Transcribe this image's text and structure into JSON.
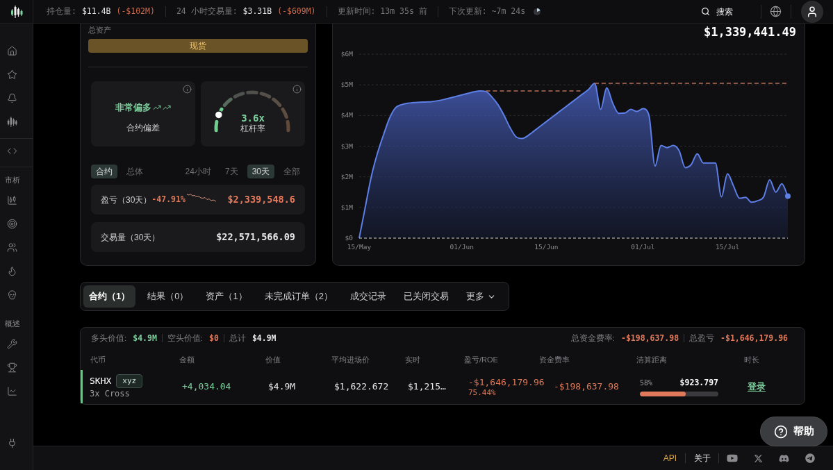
{
  "top_bar": {
    "stats": [
      {
        "label": "持仓量:",
        "value": "$11.4B",
        "change": "(-$102M)"
      },
      {
        "label": "24 小时交易量:",
        "value": "$3.31B",
        "change": "(-$609M)"
      }
    ],
    "updated": "更新时间: 13m 35s 前",
    "next_update": "下次更新: ~7m 24s",
    "search": "搜索"
  },
  "sidebar": {
    "section_labels": [
      "市析",
      "概述"
    ]
  },
  "overview": {
    "title": "总资产",
    "spot_button": "现货",
    "bias": {
      "value": "非常偏多",
      "label": "合约偏差"
    },
    "leverage": {
      "value": "3.6x",
      "label": "杠杆率",
      "level": 0.15
    },
    "scope_tabs": [
      {
        "label": "合约",
        "selected": true
      },
      {
        "label": "总体",
        "selected": false
      }
    ],
    "period_tabs": [
      {
        "label": "24小时",
        "selected": false
      },
      {
        "label": "7天",
        "selected": false
      },
      {
        "label": "30天",
        "selected": true
      },
      {
        "label": "全部",
        "selected": false
      }
    ],
    "pnl": {
      "label": "盈亏（30天）",
      "change": "-47.91%",
      "value": "$2,339,548.6"
    },
    "volume": {
      "label": "交易量（30天）",
      "value": "$22,571,566.09"
    }
  },
  "chart_panel": {
    "total_value": "$1,339,441.49",
    "chart_data": [
      {
        "type": "area",
        "x": [
          "--05-15",
          "--05-16",
          "--05-17",
          "--05-18",
          "--05-19",
          "--05-20",
          "--05-21",
          "--05-22",
          "--05-23",
          "--05-24",
          "--05-25",
          "--05-26",
          "--05-27",
          "--05-28",
          "--05-29",
          "--05-30",
          "--05-31",
          "--06-01",
          "--06-02",
          "--06-03",
          "--06-04",
          "--06-05",
          "--06-06",
          "--06-07",
          "--06-08",
          "--06-09",
          "--06-10",
          "--06-11",
          "--06-12",
          "--06-13",
          "--06-14",
          "--06-15",
          "--06-16",
          "--06-17",
          "--06-18",
          "--06-19",
          "--06-20",
          "--06-21",
          "--06-22",
          "--06-23",
          "--06-24",
          "--06-25",
          "--06-26",
          "--06-27",
          "--06-28",
          "--06-29",
          "--06-30",
          "--07-01",
          "--07-02",
          "--07-03",
          "--07-04",
          "--07-05",
          "--07-06",
          "--07-07",
          "--07-08",
          "--07-09",
          "--07-10",
          "--07-11",
          "--07-12",
          "--07-13",
          "--07-14",
          "--07-15",
          "--07-16",
          "--07-17",
          "--07-18",
          "--07-19",
          "--07-20",
          "--07-21",
          "--07-22",
          "--07-23",
          "--07-24",
          "--07-25"
        ],
        "series": [
          {
            "color": "#5d7fe6",
            "values": [
              0,
              1000000,
              2000000,
              2750000,
              3350000,
              3900000,
              4250000,
              4350000,
              4400000,
              4420000,
              4430000,
              4440000,
              4450000,
              4480000,
              4520000,
              4570000,
              4620000,
              4670000,
              4720000,
              4770000,
              4800000,
              4780000,
              4600000,
              4350000,
              4000000,
              3600000,
              3300000,
              3250000,
              3350000,
              3500000,
              3650000,
              3800000,
              3950000,
              4100000,
              4250000,
              4400000,
              4550000,
              4700000,
              4850000,
              5050000,
              4200000,
              4900000,
              4400000,
              4070000,
              4080000,
              4200000,
              4130000,
              4220000,
              4000000,
              2350000,
              3020000,
              2950000,
              3020000,
              2850000,
              2300000,
              2400000,
              2750000,
              2450000,
              2450000,
              2450000,
              1350000,
              2100000,
              1700000,
              1300000,
              1330000,
              1170000,
              1220000,
              1350000,
              1900000,
              1500000,
              1770000,
              1370000
            ]
          },
          {
            "type": "line",
            "line_style": "dashed",
            "color": "#b8705a",
            "values": [
              null,
              null,
              null,
              null,
              null,
              null,
              null,
              null,
              null,
              null,
              null,
              null,
              null,
              null,
              null,
              null,
              null,
              null,
              null,
              null,
              null,
              4800000,
              4800000,
              4800000,
              4800000,
              4800000,
              4800000,
              4800000,
              4800000,
              4800000,
              4800000,
              4800000,
              4800000,
              4800000,
              4800000,
              4800000,
              4800000,
              4800000,
              null,
              5050000,
              5050000,
              5050000,
              5050000,
              5050000,
              5050000,
              5050000,
              5050000,
              5050000,
              5050000,
              5050000,
              5050000,
              5050000,
              5050000,
              5050000,
              5050000,
              5050000,
              5050000,
              5050000,
              5050000,
              5050000,
              5050000,
              5050000,
              5050000,
              5050000,
              5050000,
              5050000,
              5050000,
              5050000,
              5050000,
              5050000,
              5050000,
              5050000
            ]
          }
        ],
        "xlim": [
          "--05-15",
          "--07-25"
        ],
        "ylim": [
          0,
          6000000
        ],
        "yticks": [
          {
            "value": 0,
            "label": "$0"
          },
          {
            "value": 1000000,
            "label": "$1M"
          },
          {
            "value": 2000000,
            "label": "$2M"
          },
          {
            "value": 3000000,
            "label": "$3M"
          },
          {
            "value": 4000000,
            "label": "$4M"
          },
          {
            "value": 5000000,
            "label": "$5M"
          },
          {
            "value": 6000000,
            "label": "$6M"
          }
        ],
        "xticks": [
          {
            "value": "--05-15",
            "label": "15/May"
          },
          {
            "value": "--06-01",
            "label": "01/Jun"
          },
          {
            "value": "--06-15",
            "label": "15/Jun"
          },
          {
            "value": "--07-01",
            "label": "01/Jul"
          },
          {
            "value": "--07-15",
            "label": "15/Jul"
          }
        ],
        "grid": true
      }
    ]
  },
  "position_tabs": [
    {
      "label": "合约（1）",
      "selected": true,
      "kind": "tab"
    },
    {
      "label": "结果（0）",
      "selected": false,
      "kind": "tab"
    },
    {
      "label": "资产（1）",
      "selected": false,
      "kind": "tab"
    },
    {
      "label": "未完成订单（2）",
      "selected": false,
      "kind": "tab"
    },
    {
      "label": "成交记录",
      "selected": false,
      "kind": "tab"
    },
    {
      "label": "已关闭交易",
      "selected": false,
      "kind": "tab"
    },
    {
      "label": "更多",
      "selected": false,
      "kind": "dropdown"
    }
  ],
  "positions": {
    "summary_left": [
      {
        "label": "多头价值:",
        "value": "$4.9M",
        "color": "#7ccf9c"
      },
      {
        "label": "空头价值:",
        "value": "$0",
        "color": "#e07a5a"
      },
      {
        "label": "总计",
        "value": "$4.9M",
        "color": "#e6e6e6"
      }
    ],
    "summary_right": [
      {
        "label": "总资金费率:",
        "value": "-$198,637.98"
      },
      {
        "label": "总盈亏",
        "value": "-$1,646,179.96"
      }
    ],
    "columns": [
      "代币",
      "金额",
      "价值",
      "平均进场价",
      "实时",
      "盈亏/ROE",
      "资金费率",
      "清算距离",
      "时长"
    ],
    "rows": [
      {
        "color": "#6fbf8f",
        "coin": "SKHX",
        "tag": "xyz",
        "margin": "3x Cross",
        "size": "+4,034.04",
        "value": "$4.9M",
        "entry": "$1,622.672",
        "mark": "$1,215…",
        "pnl": "-$1,646,179.96",
        "roe": "75.44%",
        "funding": "-$198,637.98",
        "liq_pct": "58%",
        "liq_price": "$923.797",
        "level": 0.58,
        "duration": "登录"
      }
    ]
  },
  "help_button": "帮助",
  "footer": {
    "links": [
      {
        "label": "API",
        "highlighted": true
      },
      {
        "label": "关于",
        "highlighted": false
      }
    ]
  }
}
